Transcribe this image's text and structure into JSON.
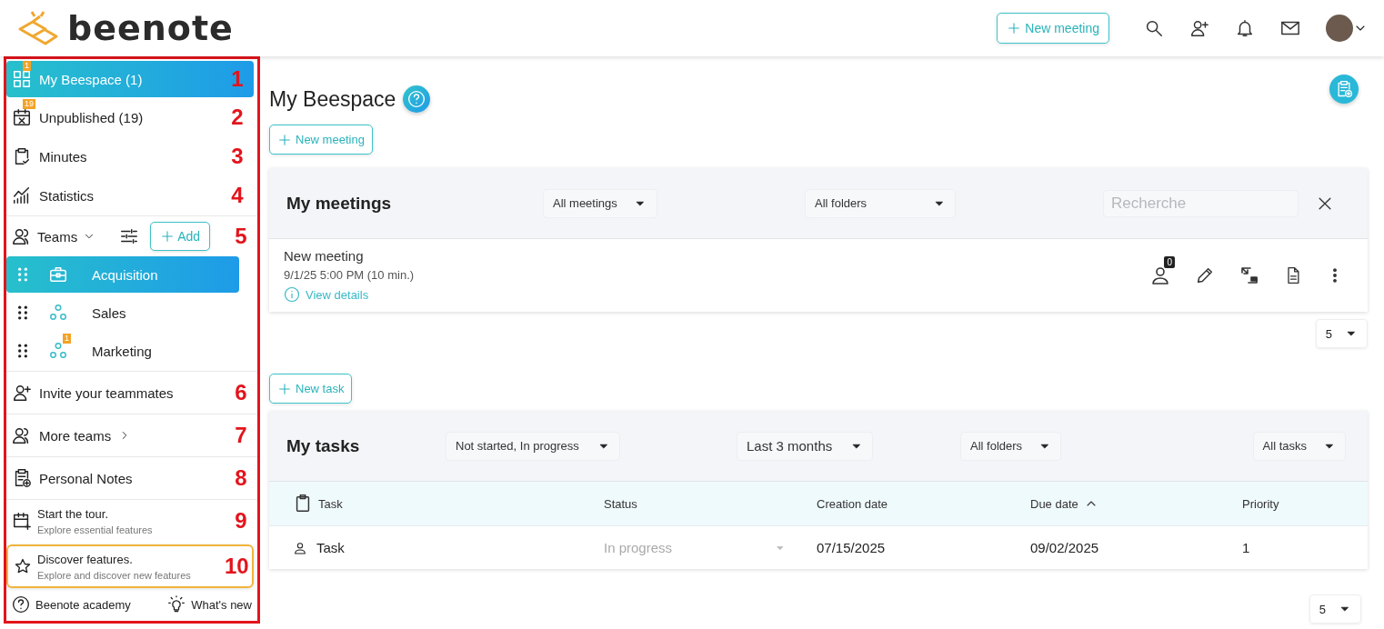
{
  "header": {
    "logo_text": "beenote",
    "new_meeting_button": "New meeting"
  },
  "sidebar": {
    "nav": [
      {
        "label": "My Beespace (1)",
        "kind": "grid",
        "badge": "1",
        "selected": true,
        "marker": "1"
      },
      {
        "label": "Unpublished (19)",
        "kind": "calendar",
        "badge": "19",
        "selected": false,
        "marker": "2"
      },
      {
        "label": "Minutes",
        "kind": "clipboard",
        "selected": false,
        "marker": "3"
      },
      {
        "label": "Statistics",
        "kind": "chart",
        "selected": false,
        "marker": "4"
      }
    ],
    "teams_header": {
      "label": "Teams",
      "add_button": "Add",
      "marker": "5"
    },
    "teams": [
      {
        "name": "Acquisition",
        "kind": "briefcase",
        "selected": true
      },
      {
        "name": "Sales",
        "kind": "circles",
        "selected": false
      },
      {
        "name": "Marketing",
        "kind": "circles",
        "badge": "1",
        "selected": false
      }
    ],
    "links": [
      {
        "label": "Invite your teammates",
        "kind": "user-plus",
        "chevron": false,
        "marker": "6"
      },
      {
        "label": "More teams",
        "kind": "users",
        "chevron": true,
        "marker": "7"
      },
      {
        "label": "Personal Notes",
        "kind": "note",
        "chevron": false,
        "marker": "8"
      }
    ],
    "tour": {
      "title": "Start the tour.",
      "subtitle": "Explore essential features",
      "marker": "9"
    },
    "discover": {
      "title": "Discover features.",
      "subtitle": "Explore and discover new features",
      "marker": "10"
    },
    "footer": [
      {
        "label": "Beenote academy",
        "kind": "help"
      },
      {
        "label": "What's new",
        "kind": "bulb"
      }
    ]
  },
  "page": {
    "title": "My Beespace",
    "new_meeting_button": "New meeting",
    "new_task_button": "New task"
  },
  "meetings": {
    "title": "My meetings",
    "filters": [
      "All meetings",
      "All folders"
    ],
    "search_placeholder": "Recherche",
    "items": [
      {
        "title": "New meeting",
        "time": "9/1/25 5:00 PM (10 min.)",
        "link": "View details",
        "participants": "0"
      }
    ],
    "page_size": "5"
  },
  "tasks": {
    "title": "My tasks",
    "filters": [
      "Not started, In progress",
      "Last 3 months",
      "All folders",
      "All tasks"
    ],
    "columns": [
      {
        "label": "Task",
        "sorted": false
      },
      {
        "label": "Status",
        "sorted": false
      },
      {
        "label": "Creation date",
        "sorted": false
      },
      {
        "label": "Due date",
        "sorted": true
      },
      {
        "label": "Priority",
        "sorted": false
      }
    ],
    "rows": [
      {
        "task": "Task",
        "status": "In progress",
        "creation_date": "07/15/2025",
        "due_date": "09/02/2025",
        "priority": "1"
      }
    ],
    "page_size": "5"
  }
}
